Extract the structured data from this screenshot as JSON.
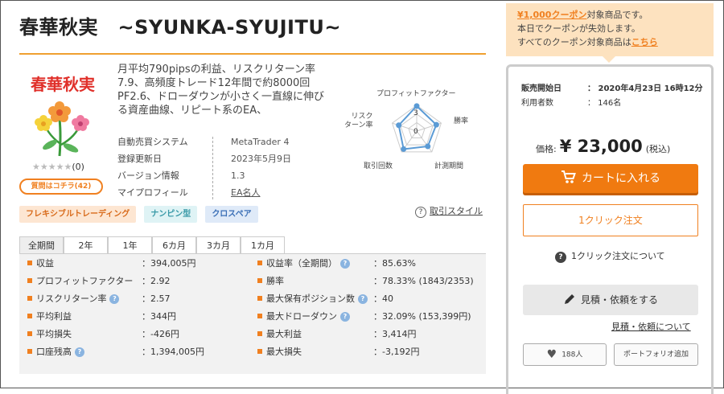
{
  "title": "春華秋実　~SYUNKA-SYUJITU~",
  "product_image_text": "春華秋実",
  "rating": {
    "stars": "★★★★★",
    "count": "(0)"
  },
  "qa_button": "質問はコチラ(42)",
  "description": "月平均790pipsの利益、リスクリターン率7.9、高頻度トレード12年間で約8000回　PF2.6、ドローダウンが小さく一直線に伸びる資産曲線、リピート系のEA、",
  "info": [
    {
      "k": "自動売買システム",
      "v": "MetaTrader 4"
    },
    {
      "k": "登録更新日",
      "v": "2023年5月9日"
    },
    {
      "k": "バージョン情報",
      "v": "1.3"
    },
    {
      "k": "マイプロフィール",
      "v": "EA名人"
    }
  ],
  "radar": {
    "labels": [
      "プロフィットファクター",
      "勝率",
      "計測期間",
      "取引回数",
      "リスク\nターン率"
    ],
    "axis_values": [
      "3",
      "0"
    ],
    "values": [
      2.92,
      2.4,
      2.2,
      2.6,
      2.2
    ],
    "max": 3,
    "color": "#5b9bd5"
  },
  "tags": [
    "フレキシブルトレーディング",
    "ナンピン型",
    "クロスペア"
  ],
  "trade_style": {
    "icon": "?",
    "label": "取引スタイル"
  },
  "period_tabs": [
    "全期間",
    "2年",
    "1年",
    "6カ月",
    "3カ月",
    "1カ月"
  ],
  "stats_left": [
    {
      "k": "収益",
      "v": "394,005円",
      "help": false
    },
    {
      "k": "プロフィットファクター",
      "v": "2.92",
      "help": false
    },
    {
      "k": "リスクリターン率",
      "v": "2.57",
      "help": true
    },
    {
      "k": "平均利益",
      "v": "344円",
      "help": false
    },
    {
      "k": "平均損失",
      "v": "-426円",
      "help": false
    },
    {
      "k": "口座残高",
      "v": "1,394,005円",
      "help": true
    }
  ],
  "stats_right": [
    {
      "k": "収益率（全期間）",
      "v": "85.63%",
      "help": true
    },
    {
      "k": "勝率",
      "v": "78.33% (1843/2353)",
      "help": false
    },
    {
      "k": "最大保有ポジション数",
      "v": "40",
      "help": true
    },
    {
      "k": "最大ドローダウン",
      "v": "32.09% (153,399円)",
      "help": true
    },
    {
      "k": "最大利益",
      "v": "3,414円",
      "help": false
    },
    {
      "k": "最大損失",
      "v": "-3,192円",
      "help": false
    }
  ],
  "coupon": {
    "highlight": "¥1,000クーポン",
    "line1_rest": "対象商品です。",
    "line2": "本日でクーポンが失効します。",
    "line3_pre": "すべてのクーポン対象商品は",
    "line3_link": "こちら"
  },
  "meta": [
    {
      "k": "販売開始日",
      "v": "：  2020年4月23日 16時12分",
      "bold": true
    },
    {
      "k": "利用者数",
      "v": "：  146名",
      "bold": false
    }
  ],
  "price": {
    "label": "価格:",
    "amount": "¥ 23,000",
    "tax": "(税込)"
  },
  "cart_button": "カートに入れる",
  "one_click_button": "1クリック注文",
  "one_click_about": "1クリック注文について",
  "quote_button": "見積・依頼をする",
  "quote_about": "見積・依頼について",
  "favorite_count": "188人",
  "portfolio_button": "ポートフォリオ追加",
  "colors": {
    "accent": "#f07a10",
    "radar": "#5b9bd5",
    "coupon_bg": "#fde2bf"
  }
}
